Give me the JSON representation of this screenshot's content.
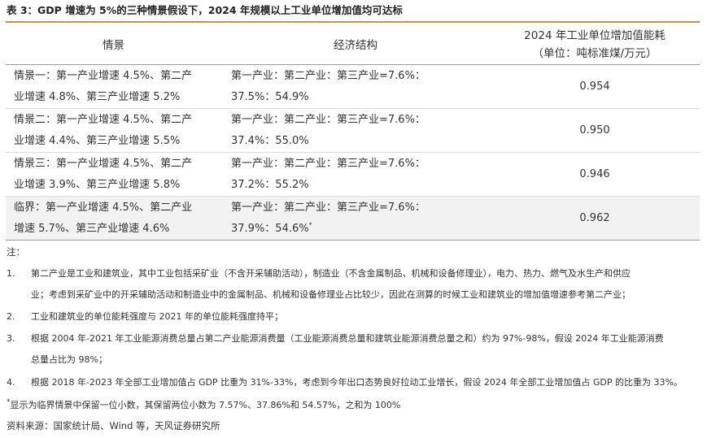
{
  "title": "表 3：GDP 增速为 5%的三种情景假设下，2024 年规模以上工业单位增加值均可达标",
  "headers": {
    "scene": "情景",
    "structure": "经济结构",
    "energy_line1": "2024 年工业单位增加值能耗",
    "energy_line2": "（单位：吨标准煤/万元）"
  },
  "rows": [
    {
      "scene_line1": "情景一：第一产业增速 4.5%、第二产",
      "scene_line2": "业增速 4.8%、第三产业增速 5.2%",
      "structure_line1": "第一产业：第二产业：第三产业=7.6%：",
      "structure_line2": "37.5%：54.9%",
      "energy": "0.954"
    },
    {
      "scene_line1": "情景二：第一产业增速 4.5%、第二产",
      "scene_line2": "业增速 4.4%、第三产业增速 5.5%",
      "structure_line1": "第一产业：第二产业：第三产业=7.6%：",
      "structure_line2": "37.4%：55.0%",
      "energy": "0.950"
    },
    {
      "scene_line1": "情景三：第一产业增速 4.5%、第二产",
      "scene_line2": "业增速 3.9%、第三产业增速 5.8%",
      "structure_line1": "第一产业：第二产业：第三产业=7.6%：",
      "structure_line2": "37.2%：55.2%",
      "energy": "0.946"
    },
    {
      "scene_line1": "临界：第一产业增速 4.5%、第二产业",
      "scene_line2": "增速 5.7%、第三产业增速 4.6%",
      "structure_line1": "第一产业：第二产业：第三产业=7.6%：",
      "structure_line2": "37.9%：54.6%",
      "structure_mark": "*",
      "energy": "0.962"
    }
  ],
  "notes_label": "注：",
  "notes": [
    {
      "num": "1.",
      "line1": "第二产业是工业和建筑业，其中工业包括采矿业（不含开采辅助活动），制造业（不含金属制品、机械和设备修理业），电力、热力、燃气及水生产和供应",
      "line2": "业；考虑到采矿业中的开采辅助活动和制造业中的金属制品、机械和设备修理业占比较少，因此在测算的时候工业和建筑业的增加值增速参考第二产业；"
    },
    {
      "num": "2.",
      "line1": "工业和建筑业的单位能耗强度与 2021 年的单位能耗强度持平；",
      "line2": ""
    },
    {
      "num": "3.",
      "line1": "根据 2004 年-2021 年工业能源消费总量占第二产业能源消费量（工业能源消费总量和建筑业能源消费总量之和）约为 97%-98%，假设 2024 年工业能源消费",
      "line2": "总量占比为 98%；"
    },
    {
      "num": "4.",
      "line1": "根据 2018 年-2023 年全部工业增加值占 GDP 比重为 31%-33%，考虑到今年出口态势良好拉动工业增长，假设 2024 年全部工业增加值占 GDP 的比重为 33%。",
      "line2": ""
    }
  ],
  "footnote_mark": "*",
  "footnote": "显示为临界情景中保留一位小数，其保留两位小数为 7.57%、37.86%和 54.57%，之和为 100%",
  "source": "资料来源：国家统计局、Wind 等，天风证券研究所",
  "colors": {
    "accent_rule": "#c8923f",
    "last_row_bg": "#f2f2f2"
  }
}
